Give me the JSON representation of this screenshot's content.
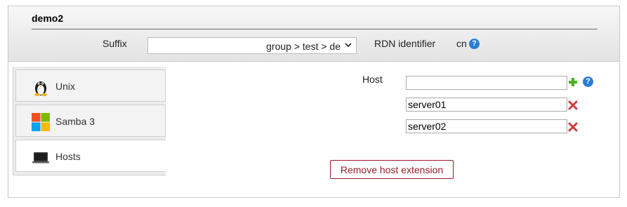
{
  "header": {
    "title": "demo2",
    "suffix_label": "Suffix",
    "suffix_value": "group > test > de",
    "rdn_label": "RDN identifier",
    "rdn_value": "cn"
  },
  "tabs": [
    {
      "label": "Unix",
      "icon": "tux-penguin-icon"
    },
    {
      "label": "Samba 3",
      "icon": "windows-logo-icon"
    },
    {
      "label": "Hosts",
      "icon": "laptop-icon"
    }
  ],
  "active_tab": "Hosts",
  "host": {
    "label": "Host",
    "new_value": "",
    "entries": [
      "server01",
      "server02"
    ]
  },
  "actions": {
    "remove_label": "Remove host extension"
  },
  "colors": {
    "help_icon": "#2a7fd5",
    "add_icon": "#4caf1e",
    "delete_icon": "#d23a3a",
    "remove_button": "#9b1c2a"
  }
}
